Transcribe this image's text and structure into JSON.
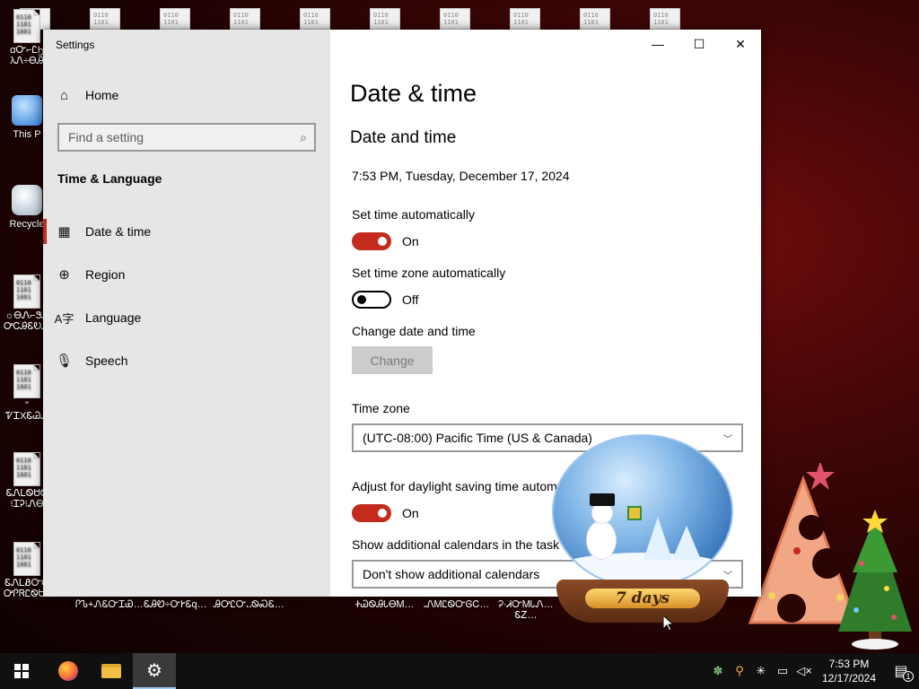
{
  "desktop": {
    "icons": [
      {
        "label": "ꭤᏅ⌐ᏝϦ\nλᏁ÷ᎾᎯ"
      },
      {
        "label": "This P"
      },
      {
        "label": "Recycle"
      },
      {
        "label": "☼ᎾᏁ⌐ᏕᎯ\nᎤᏟᎯᏋᎧᎯᎤᎳ"
      },
      {
        "label": "\" ᏤᏆXᏋᏊᎯ"
      },
      {
        "label": "ᏋᏁᏞᏫᏌᏫ\n⁝ᏆᎮ⁝ᏁᎾ"
      },
      {
        "label": "ᏋᏁᏞᏰᏅᏫ\nᎤᎵᏒᏝᏫᏌ…"
      }
    ],
    "bottom_labels": [
      "ᎵᏖ+ᏁᏋᏅᏆᏯ…",
      "ᏋᎯᏬ÷ᏅᎨᏋq…",
      "ᎯᎤᏝᏅ᎑ᏫᏍᏋ…",
      "ᏐᏊᏫᎯᏓᎾᎷ…",
      "᎐ᏁᎷᏝᏫᏅᎶᏟ…",
      "Ꭾ·ᏗᏅᎷᏓᏁ…ᏋᏃ…"
    ]
  },
  "window": {
    "title": "Settings",
    "controls": {
      "minimize": "—",
      "maximize": "☐",
      "close": "✕"
    },
    "sidebar": {
      "home": "Home",
      "search_placeholder": "Find a setting",
      "section": "Time & Language",
      "items": [
        {
          "label": "Date & time",
          "icon": "calendar-clock-icon",
          "active": true
        },
        {
          "label": "Region",
          "icon": "globe-icon",
          "active": false
        },
        {
          "label": "Language",
          "icon": "language-icon",
          "active": false
        },
        {
          "label": "Speech",
          "icon": "microphone-icon",
          "active": false
        }
      ]
    },
    "main": {
      "page_title": "Date & time",
      "section_title": "Date and time",
      "current_datetime": "7:53 PM, Tuesday, December 17, 2024",
      "set_time_auto": {
        "label": "Set time automatically",
        "state": "On"
      },
      "set_timezone_auto": {
        "label": "Set time zone automatically",
        "state": "Off"
      },
      "change_date_time": {
        "label": "Change date and time",
        "button": "Change"
      },
      "time_zone": {
        "label": "Time zone",
        "value": "(UTC-08:00) Pacific Time (US & Canada)"
      },
      "dst": {
        "label": "Adjust for daylight saving time autom",
        "state": "On"
      },
      "calendars": {
        "label": "Show additional calendars in the task",
        "value": "Don't show additional calendars"
      }
    }
  },
  "widget": {
    "countdown": "7 days"
  },
  "taskbar": {
    "clock_time": "7:53 PM",
    "clock_date": "12/17/2024",
    "notification_count": "1"
  },
  "colors": {
    "accent": "#c42b1c",
    "sidebar": "#e6e6e6",
    "taskbar": "#101010"
  }
}
